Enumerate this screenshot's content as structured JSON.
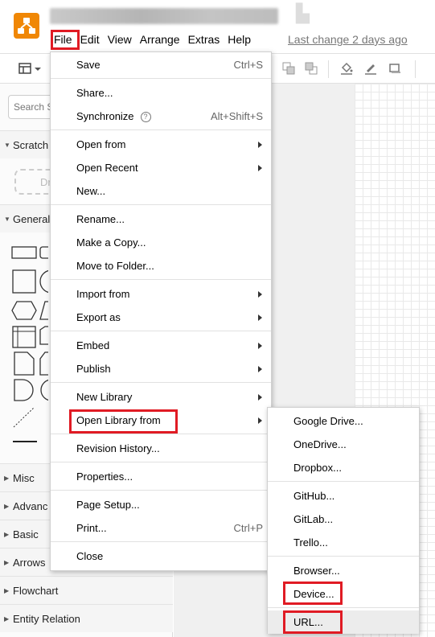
{
  "app": {
    "menubar": [
      "File",
      "Edit",
      "View",
      "Arrange",
      "Extras",
      "Help"
    ],
    "last_change": "Last change 2 days ago",
    "accent": "#f08705"
  },
  "sidebar": {
    "search_placeholder": "Search S",
    "scratchpad": "Scratch",
    "drag_hint": "Dr",
    "general": "General",
    "sections": [
      "Misc",
      "Advanc",
      "Basic",
      "Arrows",
      "Flowchart",
      "Entity Relation"
    ]
  },
  "file_menu": {
    "groups": [
      [
        {
          "label": "Save",
          "shortcut": "Ctrl+S"
        }
      ],
      [
        {
          "label": "Share..."
        },
        {
          "label": "Synchronize",
          "help": "?",
          "shortcut": "Alt+Shift+S"
        }
      ],
      [
        {
          "label": "Open from",
          "submenu": true
        },
        {
          "label": "Open Recent",
          "submenu": true
        },
        {
          "label": "New..."
        }
      ],
      [
        {
          "label": "Rename..."
        },
        {
          "label": "Make a Copy..."
        },
        {
          "label": "Move to Folder..."
        }
      ],
      [
        {
          "label": "Import from",
          "submenu": true
        },
        {
          "label": "Export as",
          "submenu": true
        }
      ],
      [
        {
          "label": "Embed",
          "submenu": true
        },
        {
          "label": "Publish",
          "submenu": true
        }
      ],
      [
        {
          "label": "New Library",
          "submenu": true
        },
        {
          "label": "Open Library from",
          "submenu": true
        }
      ],
      [
        {
          "label": "Revision History..."
        }
      ],
      [
        {
          "label": "Properties..."
        }
      ],
      [
        {
          "label": "Page Setup..."
        },
        {
          "label": "Print...",
          "shortcut": "Ctrl+P"
        }
      ],
      [
        {
          "label": "Close"
        }
      ]
    ]
  },
  "library_submenu": {
    "groups": [
      [
        "Google Drive...",
        "OneDrive...",
        "Dropbox..."
      ],
      [
        "GitHub...",
        "GitLab...",
        "Trello..."
      ],
      [
        "Browser...",
        "Device..."
      ],
      [
        "URL..."
      ]
    ]
  },
  "colors": {
    "highlight": "#e01b24",
    "menu_border": "#d0d0d0"
  }
}
